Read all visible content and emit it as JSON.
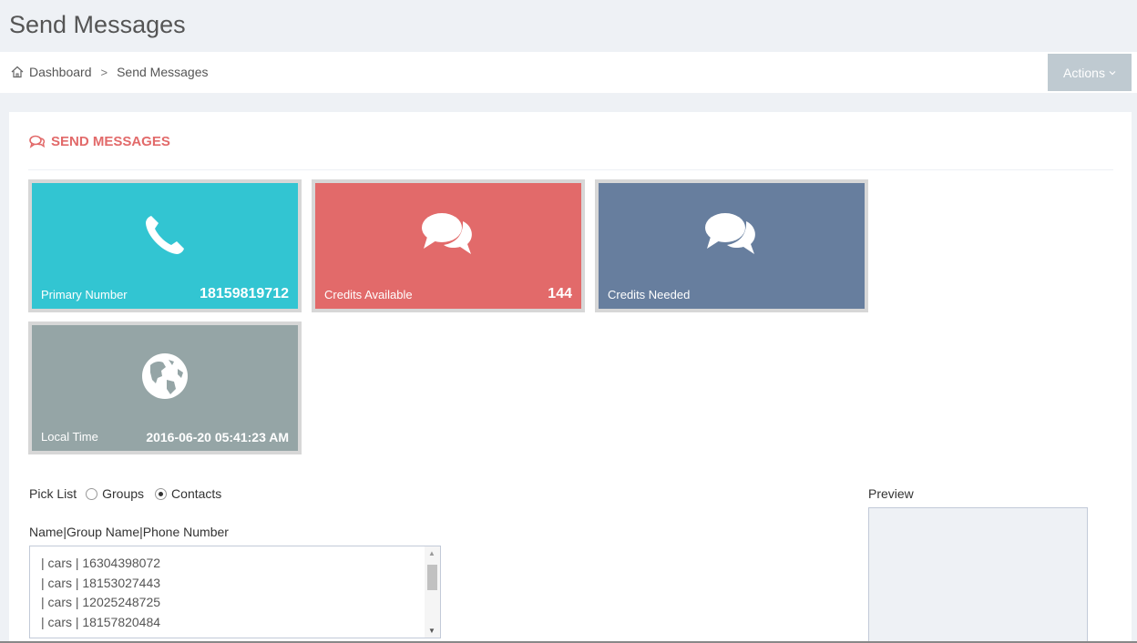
{
  "page": {
    "title": "Send Messages"
  },
  "breadcrumb": {
    "home": "Dashboard",
    "separator": ">",
    "current": "Send Messages"
  },
  "toolbar": {
    "actions_label": "Actions",
    "actions_chevron": "⌄"
  },
  "portlet": {
    "title": "SEND MESSAGES",
    "accent": "#e26a6a"
  },
  "tiles": {
    "primary": {
      "label": "Primary Number",
      "value": "18159819712",
      "icon": "phone-icon",
      "color": "#32c5d2"
    },
    "credits_available": {
      "label": "Credits Available",
      "value": "144",
      "icon": "comments-icon",
      "color": "#e26a6a"
    },
    "credits_needed": {
      "label": "Credits Needed",
      "value": "",
      "icon": "comments-icon",
      "color": "#677e9e"
    },
    "local_time": {
      "label": "Local Time",
      "value": "2016-06-20 05:41:23 AM",
      "icon": "globe-icon",
      "color": "#95a5a6"
    }
  },
  "picklist": {
    "label": "Pick List",
    "options": [
      "Groups",
      "Contacts"
    ],
    "selected": "Contacts"
  },
  "contacts": {
    "header": "Name|Group Name|Phone Number",
    "items": [
      " | cars | 16304398072",
      " | cars | 18153027443",
      " | cars | 12025248725",
      " | cars | 18157820484"
    ]
  },
  "preview": {
    "label": "Preview"
  }
}
